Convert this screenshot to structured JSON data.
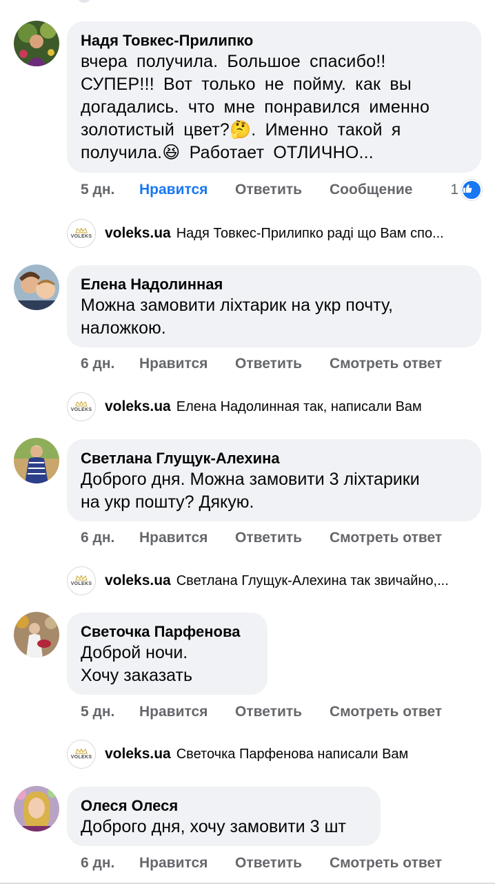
{
  "colors": {
    "link": "#1877f2",
    "muted": "#65676b",
    "bubble": "#f0f2f5"
  },
  "comments": [
    {
      "author": "Надя Товкес-Прилипко",
      "text": "вчера получила. Большое спасибо!!\nСУПЕР!!! Вот только не пойму. как вы\nдогадались. что мне понравился именно\nзолотистый цвет?🤔. Именно такой я\nполучила.😆 Работает ОТЛИЧНО...",
      "time": "5 дн.",
      "like": "Нравится",
      "reply": "Ответить",
      "extra": "Сообщение",
      "reaction_count": "1",
      "reply_author": "voleks.ua",
      "reply_text": "Надя Товкес-Прилипко раді що Вам спо..."
    },
    {
      "author": "Елена Надолинная",
      "text": "Можна замовити ліхтарик на укр почту,\nналожкою.",
      "time": "6 дн.",
      "like": "Нравится",
      "reply": "Ответить",
      "extra": "Смотреть ответ",
      "reply_author": "voleks.ua",
      "reply_text": "Елена Надолинная так, написали Вам"
    },
    {
      "author": "Светлана Глущук-Алехина",
      "text": "Доброго дня. Можна замовити 3 ліхтарики\nна укр пошту? Дякую.",
      "time": "6 дн.",
      "like": "Нравится",
      "reply": "Ответить",
      "extra": "Смотреть ответ",
      "reply_author": "voleks.ua",
      "reply_text": "Светлана Глущук-Алехина так звичайно,..."
    },
    {
      "author": "Светочка Парфенова",
      "text": "Доброй ночи.\nХочу заказать",
      "time": "5 дн.",
      "like": "Нравится",
      "reply": "Ответить",
      "extra": "Смотреть ответ",
      "reply_author": "voleks.ua",
      "reply_text": "Светочка Парфенова написали Вам"
    },
    {
      "author": "Олеся Олеся",
      "text": "Доброго дня, хочу замовити 3 шт",
      "time": "6 дн.",
      "like": "Нравится",
      "reply": "Ответить",
      "extra": "Смотреть ответ"
    }
  ],
  "logo_word": "VOLEKS"
}
